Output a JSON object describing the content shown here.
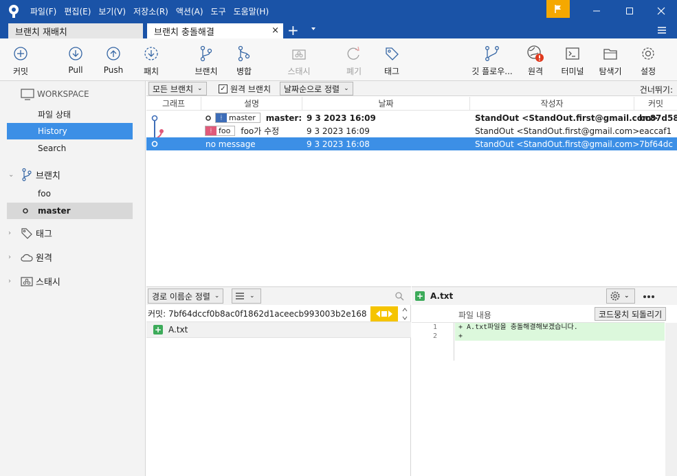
{
  "menu": [
    "파일(F)",
    "편집(E)",
    "보기(V)",
    "저장소(R)",
    "액션(A)",
    "도구",
    "도움말(H)"
  ],
  "tabs": {
    "inactive_label": "브랜치 재배치",
    "active_label": "브랜치 충돌해결",
    "add_symbol": "+",
    "close_symbol": "×"
  },
  "toolbar": {
    "commit": "커밋",
    "pull": "Pull",
    "push": "Push",
    "fetch": "패치",
    "branch": "브랜치",
    "merge": "병합",
    "stash": "스태시",
    "discard": "폐기",
    "tag": "태그",
    "git_flow": "깃 플로우...",
    "remote": "원격",
    "terminal": "터미널",
    "explorer": "탐색기",
    "settings": "설정"
  },
  "sidebar": {
    "workspace": "WORKSPACE",
    "file_status": "파일 상태",
    "history": "History",
    "search": "Search",
    "branches": "브랜치",
    "branch_items": [
      "foo",
      "master"
    ],
    "tags": "태그",
    "remotes": "원격",
    "stashes": "스태시"
  },
  "filterbar": {
    "all_branches": "모든 브랜치",
    "remote_branches": "원격 브랜치",
    "sort_by_date": "날짜순으로 정렬",
    "jump_to": "건너뛰기:"
  },
  "columns": {
    "graph": "그래프",
    "description": "설명",
    "date": "날짜",
    "author": "작성자",
    "commit": "커밋"
  },
  "commits": [
    {
      "branch": "master",
      "message": "master:",
      "date": "9 3 2023 16:09",
      "author": "StandOut <StandOut.first@gmail.com>",
      "hash": "bc87d58"
    },
    {
      "branch": "foo",
      "message": "foo가 수정",
      "date": "9 3 2023 16:09",
      "author": "StandOut <StandOut.first@gmail.com>",
      "hash": "eaccaf1"
    },
    {
      "message": "no message",
      "date": "9 3 2023 16:08",
      "author": "StandOut <StandOut.first@gmail.com>",
      "hash": "7bf64dc"
    }
  ],
  "bottom_left": {
    "sort_by_path": "경로 이름순 정렬",
    "commit_info": "커밋: 7bf64dccf0b8ac0f1862d1aceecb993003b2e168",
    "file_name": "A.txt"
  },
  "bottom_right": {
    "file_name": "A.txt",
    "file_content_label": "파일 내용",
    "revert_hunk": "코드뭉치 되돌리기",
    "line_numbers": [
      "1",
      "2"
    ],
    "diff_lines": [
      "+ A.txt파일을 충돌해결해보겠습니다.",
      "+"
    ]
  },
  "colors": {
    "titlebar": "#1a53a7",
    "selection": "#3c8fe6",
    "flag": "#f5a800",
    "added": "#3dab5a",
    "diff_added_bg": "#dcf8dc"
  }
}
